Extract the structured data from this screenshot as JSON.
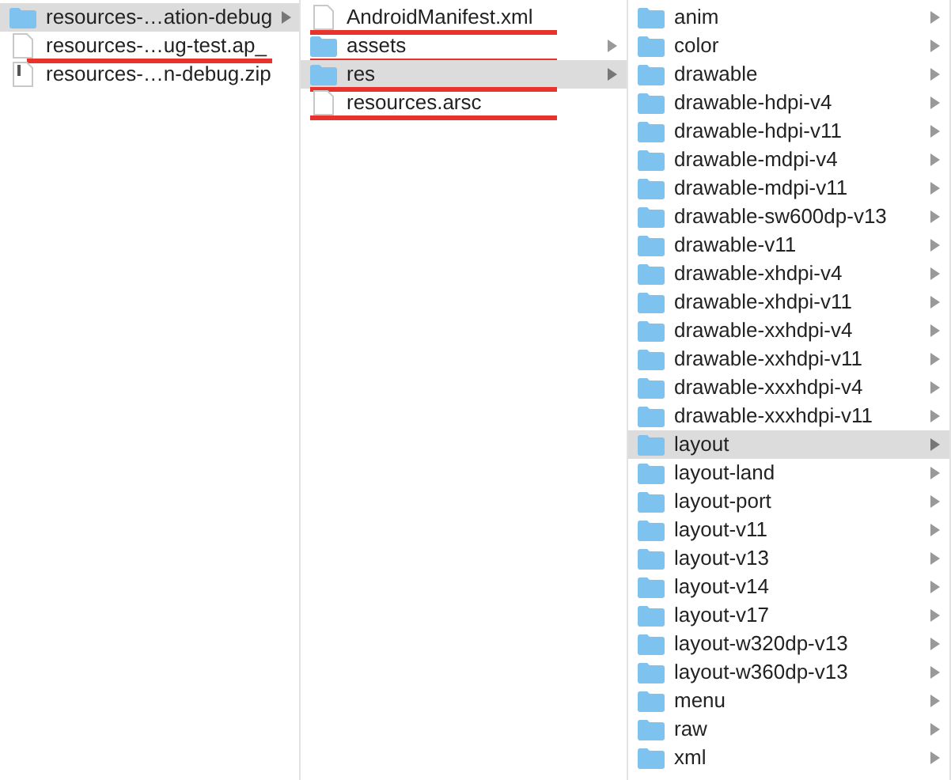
{
  "columns": [
    {
      "items": [
        {
          "name": "resources-…ation-debug",
          "kind": "folder",
          "selected": true,
          "underlined": false
        },
        {
          "name": "resources-…ug-test.ap_",
          "kind": "file",
          "selected": false,
          "underlined": true
        },
        {
          "name": "resources-…n-debug.zip",
          "kind": "zip",
          "selected": false,
          "underlined": false
        }
      ]
    },
    {
      "items": [
        {
          "name": "AndroidManifest.xml",
          "kind": "file",
          "selected": false,
          "underlined": true
        },
        {
          "name": "assets",
          "kind": "folder",
          "selected": false,
          "underlined": true
        },
        {
          "name": "res",
          "kind": "folder",
          "selected": true,
          "underlined": true
        },
        {
          "name": "resources.arsc",
          "kind": "file",
          "selected": false,
          "underlined": true
        }
      ]
    },
    {
      "items": [
        {
          "name": "anim",
          "kind": "folder",
          "selected": false,
          "underlined": false
        },
        {
          "name": "color",
          "kind": "folder",
          "selected": false,
          "underlined": false
        },
        {
          "name": "drawable",
          "kind": "folder",
          "selected": false,
          "underlined": false
        },
        {
          "name": "drawable-hdpi-v4",
          "kind": "folder",
          "selected": false,
          "underlined": false
        },
        {
          "name": "drawable-hdpi-v11",
          "kind": "folder",
          "selected": false,
          "underlined": false
        },
        {
          "name": "drawable-mdpi-v4",
          "kind": "folder",
          "selected": false,
          "underlined": false
        },
        {
          "name": "drawable-mdpi-v11",
          "kind": "folder",
          "selected": false,
          "underlined": false
        },
        {
          "name": "drawable-sw600dp-v13",
          "kind": "folder",
          "selected": false,
          "underlined": false
        },
        {
          "name": "drawable-v11",
          "kind": "folder",
          "selected": false,
          "underlined": false
        },
        {
          "name": "drawable-xhdpi-v4",
          "kind": "folder",
          "selected": false,
          "underlined": false
        },
        {
          "name": "drawable-xhdpi-v11",
          "kind": "folder",
          "selected": false,
          "underlined": false
        },
        {
          "name": "drawable-xxhdpi-v4",
          "kind": "folder",
          "selected": false,
          "underlined": false
        },
        {
          "name": "drawable-xxhdpi-v11",
          "kind": "folder",
          "selected": false,
          "underlined": false
        },
        {
          "name": "drawable-xxxhdpi-v4",
          "kind": "folder",
          "selected": false,
          "underlined": false
        },
        {
          "name": "drawable-xxxhdpi-v11",
          "kind": "folder",
          "selected": false,
          "underlined": false
        },
        {
          "name": "layout",
          "kind": "folder",
          "selected": true,
          "underlined": false
        },
        {
          "name": "layout-land",
          "kind": "folder",
          "selected": false,
          "underlined": false
        },
        {
          "name": "layout-port",
          "kind": "folder",
          "selected": false,
          "underlined": false
        },
        {
          "name": "layout-v11",
          "kind": "folder",
          "selected": false,
          "underlined": false
        },
        {
          "name": "layout-v13",
          "kind": "folder",
          "selected": false,
          "underlined": false
        },
        {
          "name": "layout-v14",
          "kind": "folder",
          "selected": false,
          "underlined": false
        },
        {
          "name": "layout-v17",
          "kind": "folder",
          "selected": false,
          "underlined": false
        },
        {
          "name": "layout-w320dp-v13",
          "kind": "folder",
          "selected": false,
          "underlined": false
        },
        {
          "name": "layout-w360dp-v13",
          "kind": "folder",
          "selected": false,
          "underlined": false
        },
        {
          "name": "menu",
          "kind": "folder",
          "selected": false,
          "underlined": false
        },
        {
          "name": "raw",
          "kind": "folder",
          "selected": false,
          "underlined": false
        },
        {
          "name": "xml",
          "kind": "folder",
          "selected": false,
          "underlined": false
        }
      ]
    }
  ]
}
